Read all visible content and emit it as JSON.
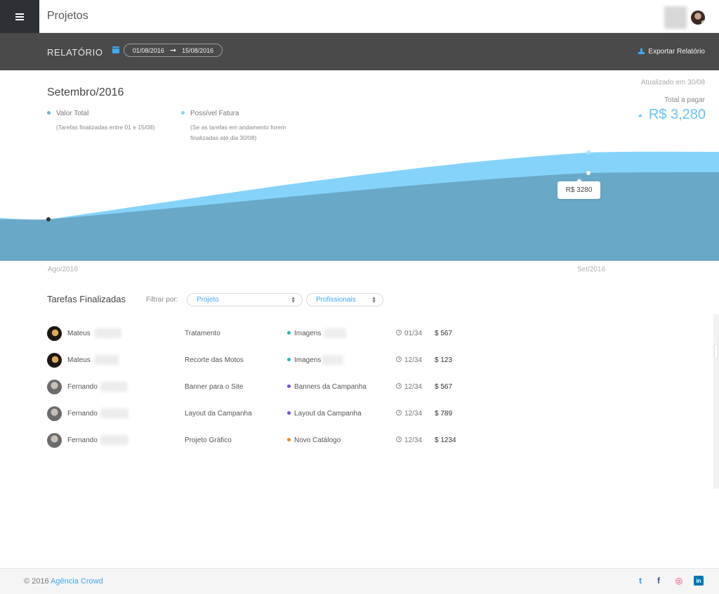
{
  "header": {
    "title": "Projetos"
  },
  "report": {
    "title": "RELATÓRIO",
    "date_start": "01/08/2016",
    "date_end": "15/08/2016",
    "export_label": "Exportar Relatório"
  },
  "summary": {
    "month": "Setembro/2016",
    "updated": "Atualizado em 30/08",
    "total_label": "Total a pagar",
    "total_value": "R$ 3,280",
    "legend": [
      {
        "label": "Valor Total",
        "sub1": "(Tarefas finalizadas entre 01 e 15/08)",
        "sub2": "",
        "color": "#6baed6"
      },
      {
        "label": "Possível Fatura",
        "sub1": "(Se as tarefas em andamento forem",
        "sub2": "finalizadas até dia 30/08)",
        "color": "#85d3fb"
      }
    ]
  },
  "chart_data": {
    "type": "area",
    "x": [
      "Ago/2016",
      "Set/2016"
    ],
    "series": [
      {
        "name": "Possível Fatura",
        "color": "#85d3fb"
      },
      {
        "name": "Valor Total",
        "color": "#6aa8c8"
      }
    ],
    "tooltip": "R$ 3280"
  },
  "tasks": {
    "title": "Tarefas Finalizadas",
    "filter_label": "Filtrar por:",
    "filter_project": "Projeto",
    "filter_professionals": "Profissionais",
    "rows": [
      {
        "name": "Mateus",
        "avatar": "mateus",
        "task": "Tratamento",
        "project": "Imagens",
        "project_color": "#26b5b5",
        "date": "01/34",
        "price": "$ 567"
      },
      {
        "name": "Mateus",
        "avatar": "mateus",
        "task": "Recorte das Motos",
        "project": "Imagens",
        "project_color": "#26b5b5",
        "date": "12/34",
        "price": "$ 123"
      },
      {
        "name": "Fernando",
        "avatar": "fernando",
        "task": "Banner para o Site",
        "project": "Banners da Campanha",
        "project_color": "#7a4fd0",
        "date": "12/34",
        "price": "$ 567"
      },
      {
        "name": "Fernando",
        "avatar": "fernando",
        "task": "Layout da Campanha",
        "project": "Layout da Campanha",
        "project_color": "#7a4fd0",
        "date": "12/34",
        "price": "$ 789"
      },
      {
        "name": "Fernando",
        "avatar": "fernando",
        "task": "Projeto Gráfico",
        "project": "Novo Catálogo",
        "project_color": "#f0892d",
        "date": "12/34",
        "price": "$ 1234"
      }
    ]
  },
  "footer": {
    "copyright": "© 2016",
    "company": "Agência Crowd",
    "social": [
      {
        "icon": "twitter-icon",
        "glyph": "t",
        "color": "#1da1f2"
      },
      {
        "icon": "facebook-icon",
        "glyph": "f",
        "color": "#3b5998"
      },
      {
        "icon": "instagram-icon",
        "glyph": "◎",
        "color": "#e1306c"
      },
      {
        "icon": "linkedin-icon",
        "glyph": "in",
        "color": "#0077b5"
      }
    ]
  }
}
